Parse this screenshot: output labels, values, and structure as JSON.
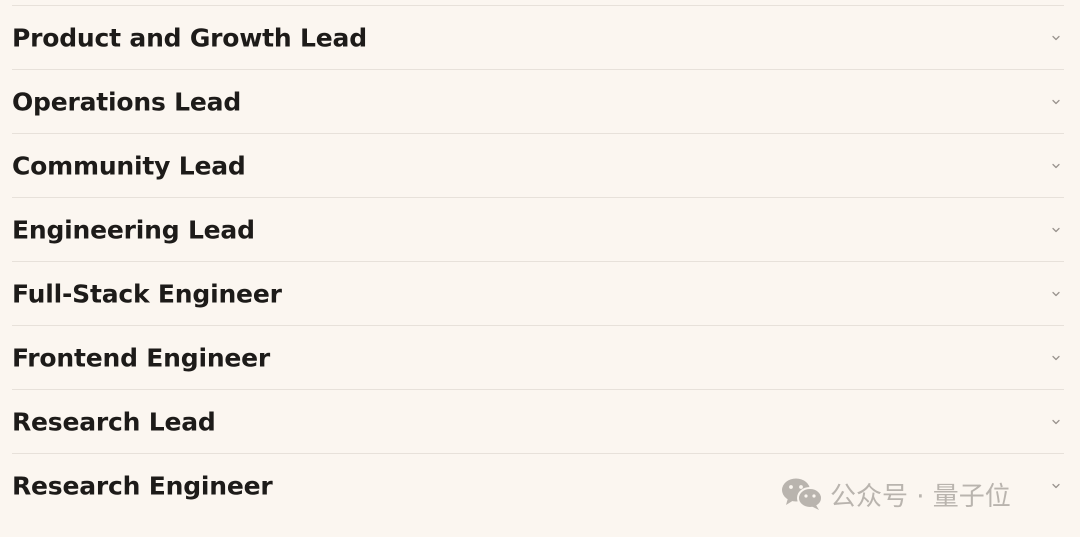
{
  "accordion": {
    "items": [
      {
        "label": "Product and Growth Lead"
      },
      {
        "label": "Operations Lead"
      },
      {
        "label": "Community Lead"
      },
      {
        "label": "Engineering Lead"
      },
      {
        "label": "Full-Stack Engineer"
      },
      {
        "label": "Frontend Engineer"
      },
      {
        "label": "Research Lead"
      },
      {
        "label": "Research Engineer"
      }
    ],
    "chevron_icon": "chevron-down-icon",
    "divider_color": "#e7e1da"
  },
  "watermark": {
    "text": "公众号 · 量子位",
    "icon": "wechat-logo-icon",
    "color": "#b9b4ae"
  },
  "colors": {
    "background": "#fbf6f0",
    "text": "#1d1b19",
    "chevron": "#9a948e"
  }
}
